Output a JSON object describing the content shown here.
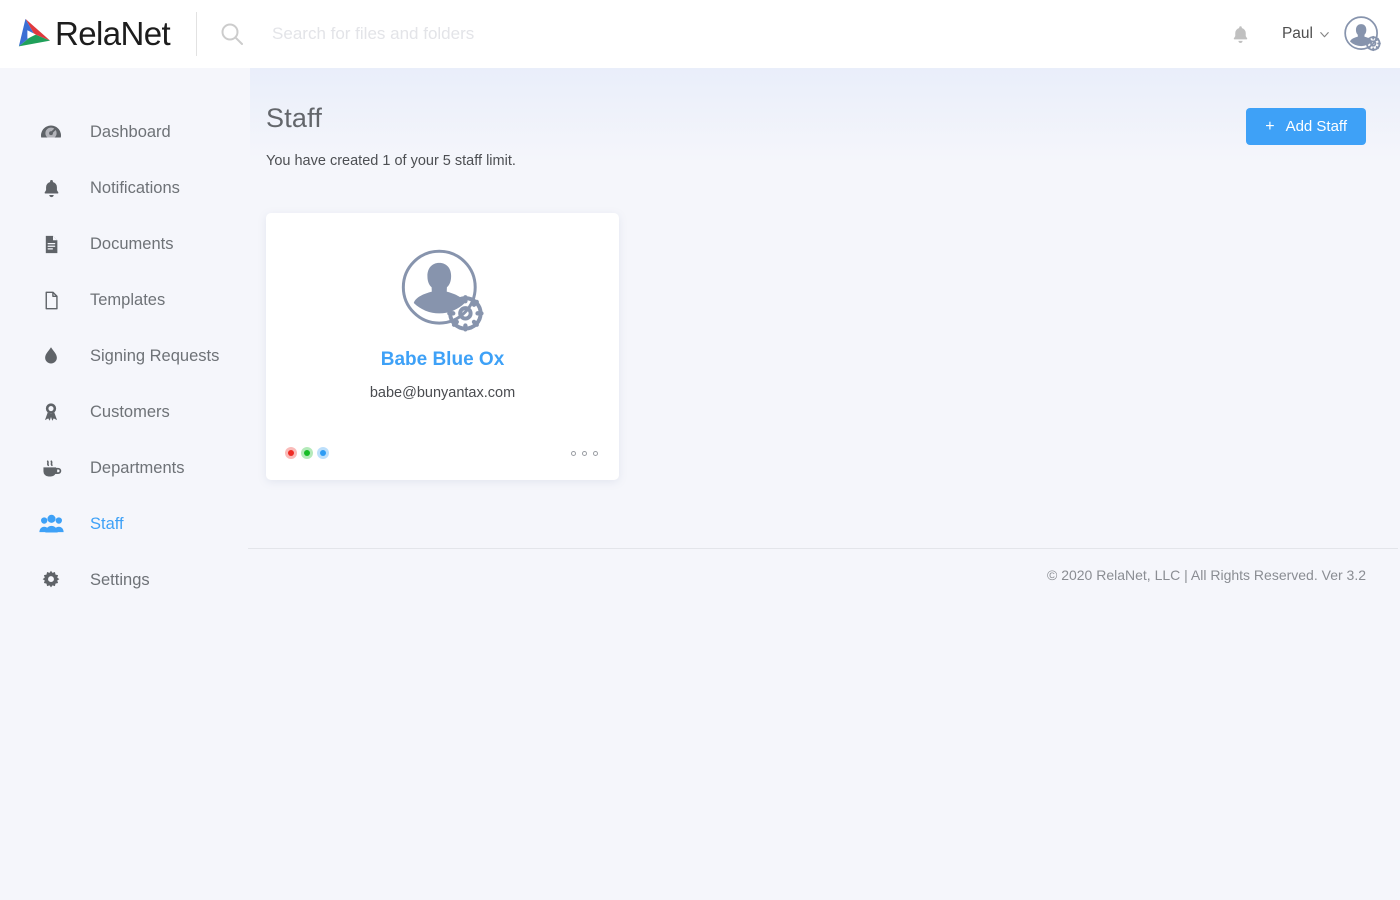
{
  "brand": {
    "name": "RelaNet",
    "logo_icon": "relanet-triangle-logo"
  },
  "search": {
    "placeholder": "Search for files and folders",
    "value": "",
    "icon": "search-icon"
  },
  "header": {
    "notifications_icon": "bell-icon",
    "user_name": "Paul",
    "chevron_icon": "chevron-down-icon",
    "avatar_icon": "user-settings-avatar-icon"
  },
  "sidebar": {
    "items": [
      {
        "label": "Dashboard",
        "icon": "gauge-icon",
        "active": false
      },
      {
        "label": "Notifications",
        "icon": "bell-icon",
        "active": false
      },
      {
        "label": "Documents",
        "icon": "document-icon",
        "active": false
      },
      {
        "label": "Templates",
        "icon": "file-icon",
        "active": false
      },
      {
        "label": "Signing Requests",
        "icon": "ink-drop-icon",
        "active": false
      },
      {
        "label": "Customers",
        "icon": "award-badge-icon",
        "active": false
      },
      {
        "label": "Departments",
        "icon": "coffee-cup-icon",
        "active": false
      },
      {
        "label": "Staff",
        "icon": "people-group-icon",
        "active": true
      },
      {
        "label": "Settings",
        "icon": "gear-icon",
        "active": false
      }
    ]
  },
  "main": {
    "title": "Staff",
    "subtitle": "You have created 1 of your 5 staff limit.",
    "add_button": {
      "label": "Add Staff",
      "plus_icon": "plus-icon",
      "color": "#3ea1f7"
    },
    "staff": [
      {
        "name": "Babe Blue Ox",
        "email": "babe@bunyantax.com",
        "avatar_icon": "user-settings-avatar-icon",
        "status_dots": [
          {
            "name": "red-status-dot",
            "color": "#ee2b24"
          },
          {
            "name": "green-status-dot",
            "color": "#17bd27"
          },
          {
            "name": "blue-status-dot",
            "color": "#2e9cf4"
          }
        ],
        "more_icon": "more-options-icon"
      }
    ]
  },
  "footer": {
    "text": "© 2020 RelaNet, LLC | All Rights Reserved. Ver 3.2"
  },
  "colors": {
    "accent": "#3ea1f7",
    "page_background": "#f5f6fb",
    "card_background": "#ffffff",
    "text_muted": "#6e7277"
  }
}
